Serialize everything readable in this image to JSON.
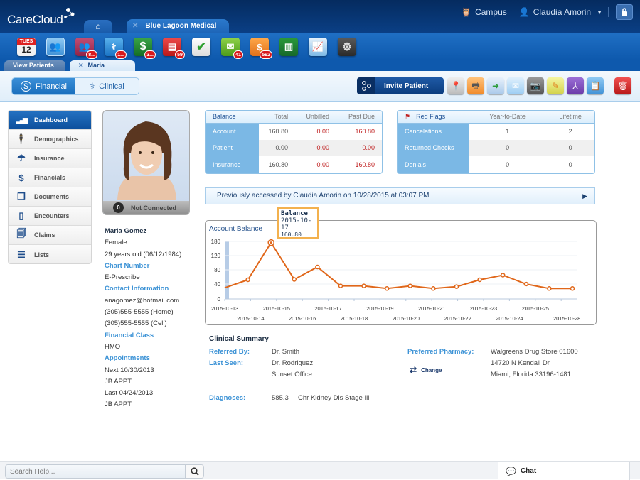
{
  "app": {
    "logo": "CareCloud",
    "practice_tab": "Blue Lagoon Medical",
    "campus_label": "Campus",
    "user_name": "Claudia Amorin"
  },
  "toolbar": {
    "calendar_day": "TUES",
    "calendar_date": "12",
    "icons": [
      {
        "name": "calendar-icon",
        "badge": null
      },
      {
        "name": "patients-icon",
        "badge": null
      },
      {
        "name": "patient-groups-icon",
        "badge": "8..."
      },
      {
        "name": "clinical-stethoscope-icon",
        "badge": "1..."
      },
      {
        "name": "billing-dollar-icon",
        "badge": "3..."
      },
      {
        "name": "documents-icon",
        "badge": "59"
      },
      {
        "name": "tasks-check-icon",
        "badge": null
      },
      {
        "name": "messages-inbox-icon",
        "badge": "41"
      },
      {
        "name": "collections-moneybag-icon",
        "badge": "592"
      },
      {
        "name": "library-icon",
        "badge": null
      },
      {
        "name": "reports-chart-icon",
        "badge": null
      },
      {
        "name": "settings-gear-icon",
        "badge": null
      }
    ]
  },
  "subtabs": {
    "view_patients": "View Patients",
    "current_patient": "Maria Gomez"
  },
  "actionbar": {
    "financial": "Financial",
    "clinical": "Clinical",
    "invite_patient": "Invite Patient"
  },
  "sidebar": {
    "items": [
      {
        "label": "Dashboard",
        "icon": "bar-chart-icon",
        "glyph": "▂▄▆"
      },
      {
        "label": "Demographics",
        "icon": "person-icon",
        "glyph": "👤"
      },
      {
        "label": "Insurance",
        "icon": "umbrella-icon",
        "glyph": "☂"
      },
      {
        "label": "Financials",
        "icon": "dollar-icon",
        "glyph": "$"
      },
      {
        "label": "Documents",
        "icon": "documents-icon",
        "glyph": "❐"
      },
      {
        "label": "Encounters",
        "icon": "clipboard-icon",
        "glyph": "▯"
      },
      {
        "label": "Claims",
        "icon": "claims-icon",
        "glyph": "🗎"
      },
      {
        "label": "Lists",
        "icon": "list-icon",
        "glyph": "☰"
      }
    ]
  },
  "patient": {
    "status_count": "0",
    "status_text": "Not Connected",
    "name": "Maria Gomez",
    "gender": "Female",
    "age": "29 years old (06/12/1984)",
    "chart_number_label": "Chart Number",
    "chart_number_value": "E-Prescribe",
    "contact_label": "Contact Information",
    "email": "anagomez@hotmail.com",
    "phone_home": "(305)555-5555 (Home)",
    "phone_cell": "(305)555-5555 (Cell)",
    "financial_class_label": "Financial Class",
    "financial_class": "HMO",
    "appointments_label": "Appointments",
    "next_appt": "Next 10/30/2013",
    "next_appt_type": "JB APPT",
    "last_appt": "Last 04/24/2013",
    "last_appt_type": "JB APPT"
  },
  "balance_table": {
    "headers": [
      "Balance",
      "Total",
      "Unbilled",
      "Past Due"
    ],
    "rows": [
      {
        "label": "Account",
        "total": "160.80",
        "unbilled": "0.00",
        "past_due": "160.80"
      },
      {
        "label": "Patient",
        "total": "0.00",
        "unbilled": "0.00",
        "past_due": "0.00"
      },
      {
        "label": "Insurance",
        "total": "160.80",
        "unbilled": "0.00",
        "past_due": "160.80"
      }
    ]
  },
  "red_flags_table": {
    "headers": [
      "Red Flags",
      "Year-to-Date",
      "Lifetime"
    ],
    "rows": [
      {
        "label": "Cancelations",
        "ytd": "1",
        "lifetime": "2"
      },
      {
        "label": "Returned Checks",
        "ytd": "0",
        "lifetime": "0"
      },
      {
        "label": "Denials",
        "ytd": "0",
        "lifetime": "0"
      }
    ]
  },
  "access_note": "Previously accessed by Claudia Amorin on 10/28/2015 at 03:07 PM",
  "tooltip": {
    "title": "Balance",
    "date": "2015-10-17",
    "value": "160.80"
  },
  "chart_data": {
    "type": "line",
    "title": "Account Balance",
    "xlabel": "",
    "ylabel": "",
    "ylim": [
      0,
      180
    ],
    "y_ticks": [
      0,
      40,
      80,
      120,
      180
    ],
    "grid": true,
    "x_tick_labels": [
      "2015-10-13",
      "2015-10-14",
      "2015-10-15",
      "2015-10-16",
      "2015-10-17",
      "2015-10-18",
      "2015-10-19",
      "2015-10-20",
      "2015-10-21",
      "2015-10-22",
      "2015-10-23",
      "2015-10-24",
      "2015-10-25",
      "2015-10-28"
    ],
    "series": [
      {
        "name": "Balance",
        "color": "#e0671a",
        "values": [
          30,
          52,
          175,
          53,
          88,
          35,
          35,
          28,
          35,
          28,
          33,
          52,
          65,
          40,
          28,
          28
        ]
      }
    ],
    "highlighted": {
      "index": 2,
      "label": "2015-10-17",
      "value": 160.8
    }
  },
  "clinical_summary": {
    "title": "Clinical Summary",
    "referred_by_label": "Referred By:",
    "referred_by": "Dr. Smith",
    "last_seen_label": "Last Seen:",
    "last_seen_doctor": "Dr. Rodriguez",
    "last_seen_office": "Sunset Office",
    "pharmacy_label": "Preferred Pharmacy:",
    "pharmacy_name": "Walgreens Drug Store 01600",
    "pharmacy_address1": "14720 N Kendall Dr",
    "pharmacy_address2": "Miami, Florida 33196-1481",
    "change_label": "Change",
    "diagnoses_label": "Diagnoses:",
    "diagnosis_code": "585.3",
    "diagnosis_desc": "Chr Kidney Dis Stage Iii"
  },
  "footer": {
    "search_placeholder": "Search Help...",
    "chat_label": "Chat"
  },
  "colors": {
    "brand_dark": "#052b5f",
    "brand_blue": "#0e59ad",
    "accent_light_blue": "#7bb8e5",
    "link_blue": "#3d93d6",
    "alert_red": "#c02222",
    "chart_orange": "#e0671a"
  }
}
